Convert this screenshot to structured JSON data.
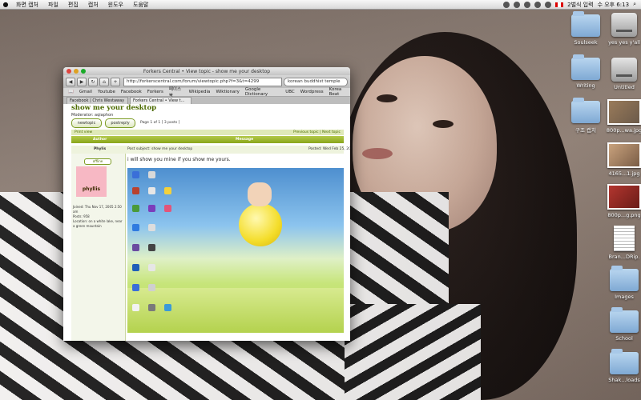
{
  "menubar": {
    "apple": "",
    "items": [
      "화면 캡처",
      "파일",
      "편집",
      "캡처",
      "윈도우",
      "도움말"
    ],
    "status": {
      "input_label": "2벌식 입력",
      "clock": "수 오후 6:13"
    }
  },
  "desktop_icons": [
    {
      "label": "Soulseek",
      "type": "folder"
    },
    {
      "label": "yes yes y'all",
      "type": "drive"
    },
    {
      "label": "Writing",
      "type": "folder"
    },
    {
      "label": "Untitled",
      "type": "drive"
    },
    {
      "label": "구조 캡처",
      "type": "folder"
    },
    {
      "label": "800p...wa.jpg",
      "type": "photo"
    },
    {
      "label": "4165...1.jpg",
      "type": "photo"
    },
    {
      "label": "800p...g.png",
      "type": "photo"
    },
    {
      "label": "Bran...DRip.",
      "type": "doc"
    },
    {
      "label": "Images",
      "type": "folder"
    },
    {
      "label": "School",
      "type": "folder"
    },
    {
      "label": "Shak...loads",
      "type": "folder"
    }
  ],
  "browser": {
    "window_title": "Forkers Central • View topic - show me your desktop",
    "url": "http://forkerscentral.com/forum/viewtopic.php?f=3&t=4299",
    "search": "korean buddhist temple",
    "bookmarks": [
      "Gmail",
      "Youtube",
      "Facebook",
      "Forkers",
      "페이스북",
      "Wikipedia",
      "Wiktionary",
      "Google Dictionary",
      "UBC",
      "Wordpress",
      "Korea Beat"
    ],
    "tabs": [
      "Facebook | Chris Westaway",
      "Forkers Central • View t..."
    ],
    "page": {
      "topic_title": "show me your desktop",
      "moderator": "Moderator: aqiaphon",
      "newtopic": "newtopic",
      "postreply": "postreply",
      "page_info": "Page 1 of 1  [ 3 posts ]",
      "print_view": "Print view",
      "prev_next": "Previous topic | Next topic",
      "col_author": "Author",
      "col_message": "Message",
      "author_name": "Phylis",
      "post_subject": "Post subject: show me your desktop",
      "posted": "Posted: Wed Feb 25, 20",
      "status": "offline",
      "avatar_text": "phyllis",
      "joined": "Joined: Thu Nov 17, 2005 2:50 am",
      "posts": "Posts: 958",
      "location": "Location: on a white lake, near a green mountain",
      "body": "i will show you mine if you show me yours."
    }
  },
  "colors": {
    "accent": "#8aa51b",
    "title_green": "#4c6b00"
  }
}
